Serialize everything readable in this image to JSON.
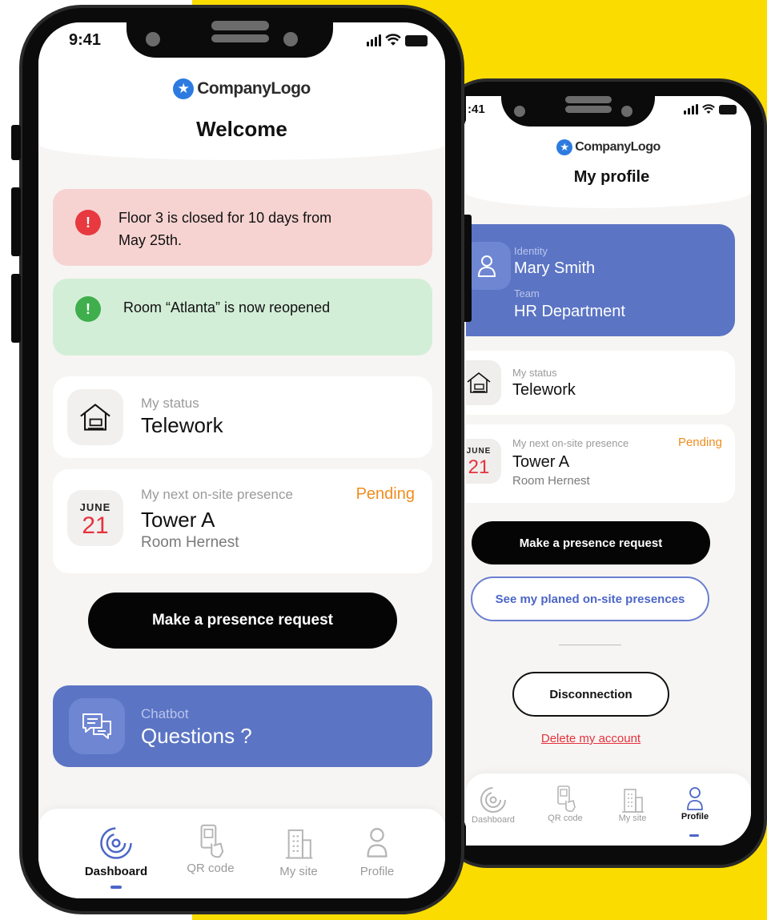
{
  "colors": {
    "yellow": "#fadc00",
    "accent_blue": "#5b74c4",
    "alert_red_bg": "#f6d3d1",
    "alert_green_bg": "#d3eed7",
    "pending_orange": "#f08d1f",
    "danger_red": "#e5323e"
  },
  "phone_main": {
    "status": {
      "time": "9:41"
    },
    "logo": {
      "icon": "star-icon",
      "text": "CompanyLogo"
    },
    "title": "Welcome",
    "alerts": [
      {
        "icon": "exclamation-icon",
        "tone": "red",
        "text_line1": "Floor 3 is closed for 10 days from",
        "text_line2": "May 25th."
      },
      {
        "icon": "exclamation-icon",
        "tone": "green",
        "text": "Room “Atlanta” is now reopened"
      }
    ],
    "status_card": {
      "icon": "house-telework-icon",
      "label": "My status",
      "value": "Telework"
    },
    "presence_card": {
      "label": "My next on-site presence",
      "badge": "Pending",
      "month": "JUNE",
      "day": "21",
      "building": "Tower A",
      "room": "Room Hernest"
    },
    "cta_button": "Make a presence request",
    "chatbot": {
      "icon": "chat-icon",
      "label": "Chatbot",
      "title": "Questions ?"
    },
    "nav": [
      {
        "label": "Dashboard",
        "icon": "dashboard-icon",
        "active": true
      },
      {
        "label": "QR code",
        "icon": "qr-scan-icon",
        "active": false
      },
      {
        "label": "My site",
        "icon": "building-icon",
        "active": false
      },
      {
        "label": "Profile",
        "icon": "user-icon",
        "active": false
      }
    ]
  },
  "phone_profile": {
    "status": {
      "time": ":41"
    },
    "logo": {
      "icon": "star-icon",
      "text": "CompanyLogo"
    },
    "title": "My profile",
    "identity_card": {
      "icon": "user-icon",
      "identity_label": "Identity",
      "identity_value": "Mary Smith",
      "team_label": "Team",
      "team_value": "HR Department"
    },
    "status_card": {
      "icon": "house-telework-icon",
      "label": "My status",
      "value": "Telework"
    },
    "presence_card": {
      "label": "My next on-site presence",
      "badge": "Pending",
      "month": "JUNE",
      "day": "21",
      "building": "Tower A",
      "room": "Room Hernest"
    },
    "cta_button": "Make a presence request",
    "secondary_button": "See my planed on-site presences",
    "disconnect_button": "Disconnection",
    "delete_link": "Delete my account",
    "nav": [
      {
        "label": "Dashboard",
        "icon": "dashboard-icon",
        "active": false
      },
      {
        "label": "QR code",
        "icon": "qr-scan-icon",
        "active": false
      },
      {
        "label": "My site",
        "icon": "building-icon",
        "active": false
      },
      {
        "label": "Profile",
        "icon": "user-icon",
        "active": true
      }
    ]
  }
}
